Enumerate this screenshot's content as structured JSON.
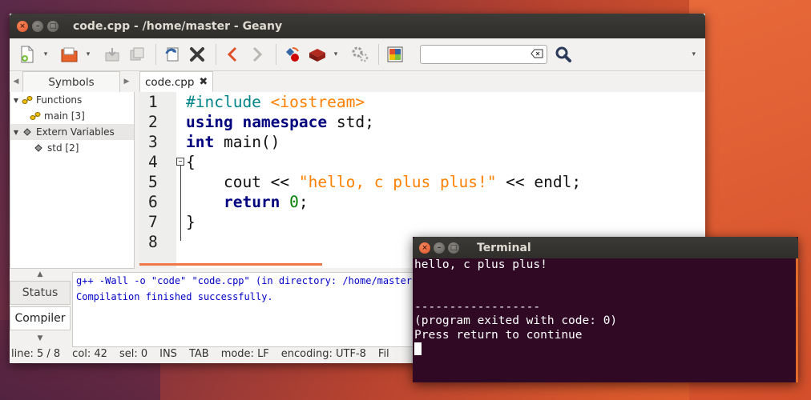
{
  "geany": {
    "title": "code.cpp - /home/master - Geany",
    "window_buttons": {
      "close": "×",
      "min": "–",
      "max": "□"
    },
    "toolbar": {
      "icons": [
        "new-file-icon",
        "open-file-icon",
        "save-icon",
        "save-all-icon",
        "reload-icon",
        "close-file-icon",
        "back-icon",
        "forward-icon",
        "compile-icon",
        "build-icon",
        "execute-icon",
        "color-chooser-icon",
        "find-icon"
      ],
      "search_value": "",
      "more": "▾",
      "drop": "▾"
    },
    "sidebar": {
      "left_arrow": "◀",
      "right_arrow": "▶",
      "tab_label": "Symbols",
      "tree": [
        {
          "expander": "▼",
          "label": "Functions",
          "indent": 0
        },
        {
          "expander": "",
          "label": "main [3]",
          "indent": 1
        },
        {
          "expander": "▼",
          "label": "Extern Variables",
          "indent": 0
        },
        {
          "expander": "",
          "label": "std [2]",
          "indent": 1
        }
      ]
    },
    "editor": {
      "tab_label": "code.cpp",
      "tab_close": "✖",
      "line_numbers": [
        "1",
        "2",
        "3",
        "4",
        "5",
        "6",
        "7",
        "8"
      ],
      "fold_marker": "−"
    },
    "messages": {
      "up_arrow": "▲",
      "down_arrow": "▼",
      "tabs": [
        "Status",
        "Compiler"
      ],
      "lines": [
        "g++ -Wall -o \"code\" \"code.cpp\" (in directory: /home/master)",
        "Compilation finished successfully."
      ]
    },
    "status": {
      "line": "line: 5 / 8",
      "col": "col: 42",
      "sel": "sel: 0",
      "ins": "INS",
      "tab": "TAB",
      "mode": "mode: LF",
      "encoding": "encoding: UTF-8",
      "filetype": "Fil"
    },
    "colors": {
      "preprocessor": "#00858a",
      "keyword": "#00007f",
      "string": "#ff8000",
      "number": "#007f00",
      "message_text": "#0000c8"
    }
  },
  "terminal": {
    "title": "Terminal",
    "lines": [
      "hello, c plus plus!",
      "",
      "",
      "------------------",
      "(program exited with code: 0)",
      "Press return to continue"
    ],
    "background": "#300a24"
  }
}
